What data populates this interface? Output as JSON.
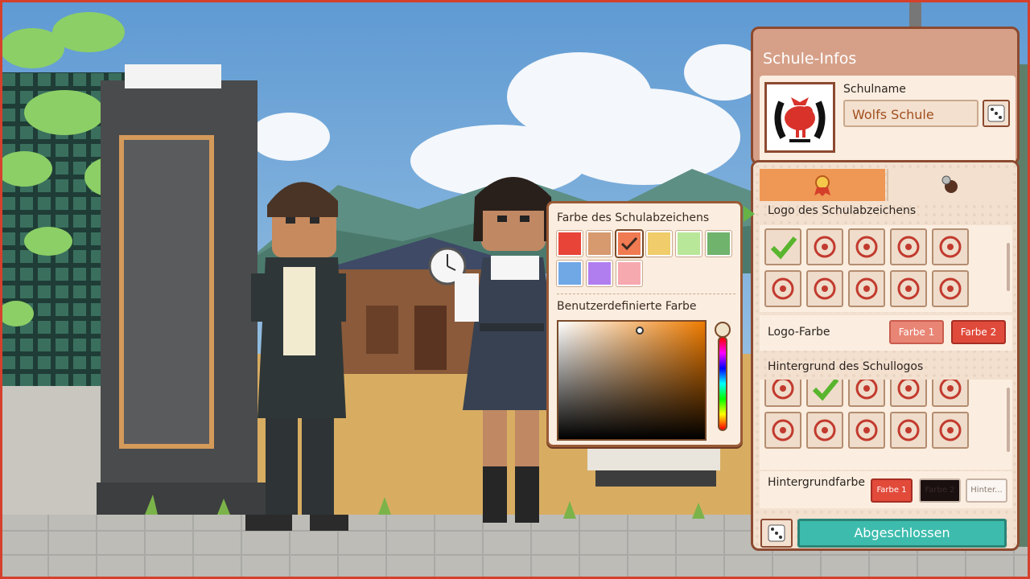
{
  "color_panel": {
    "title": "Farbe des Schulabzeichens",
    "swatches": [
      "#e84437",
      "#d69a6e",
      "#f07a52",
      "#f0cd6a",
      "#b9e79a",
      "#6fb36c",
      "#70a8e6",
      "#b17ef0",
      "#f7a9b0"
    ],
    "selected_swatch": 2,
    "custom_title": "Benutzerdefinierte Farbe",
    "picker_hue_color": "#ee7b00"
  },
  "notebook": {
    "title": "Schule-Infos",
    "school_name_label": "Schulname",
    "school_name_value": "Wolfs Schule",
    "tabs": [
      {
        "icon": "badge-ribbon-icon",
        "active": true
      },
      {
        "icon": "character-icon",
        "active": false
      }
    ],
    "logo_section_title": "Logo des Schulabzeichens",
    "logo_icons": [
      "selected-check-icon",
      "lotus-icon",
      "flower-icon",
      "bird-icon",
      "chicken-icon",
      "cat-face-icon",
      "temple-icon",
      "pattern-icon",
      "palette-icon",
      "scroll-icon"
    ],
    "logo_color_label": "Logo-Farbe",
    "logo_color_buttons": [
      "Farbe 1",
      "Farbe 2"
    ],
    "background_section_title": "Hintergrund des Schullogos",
    "background_icons": [
      "shield-icon",
      "laurel-check-icon",
      "horseshoe-icon",
      "wreath-icon",
      "ornate-ring-icon",
      "star-frame-icon",
      "double-circle-icon",
      "triangle-frame-icon",
      "square-frame-icon",
      "laurel-wreath-icon"
    ],
    "background_color_label": "Hintergrundfarbe",
    "background_color_buttons": [
      "Farbe 1",
      "Farbe 2",
      "Hinter..."
    ],
    "done_label": "Abgeschlossen"
  },
  "colors": {
    "accent_orange": "#ef9754",
    "done_teal": "#3dbcad",
    "panel_border": "#8c4a30",
    "farbe1_light": "#e98575",
    "farbe2_red": "#e04a3b",
    "bg_farbe1": "#e24a3a",
    "bg_farbe2": "#1a1010"
  }
}
